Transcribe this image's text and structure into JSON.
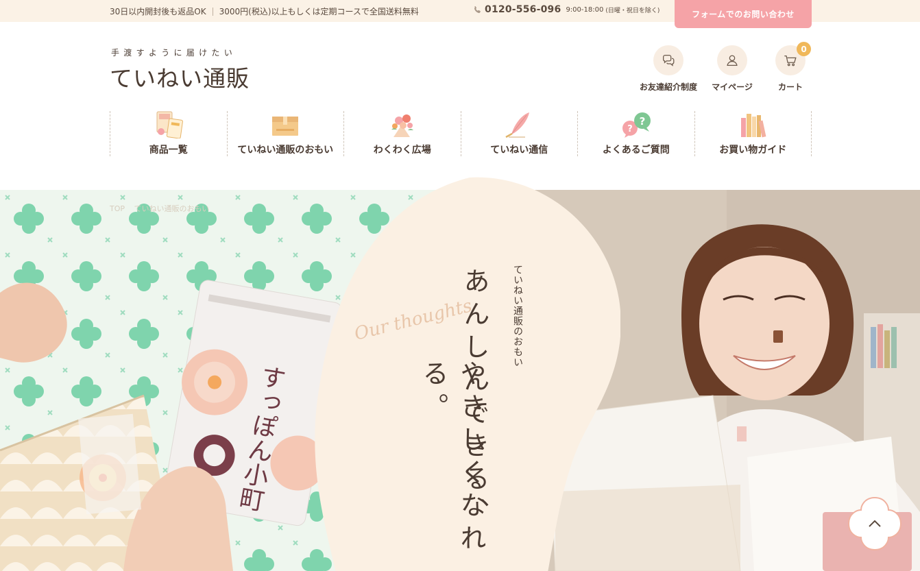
{
  "topbar": {
    "notice_left": "30日以内開封後も返品OK",
    "notice_right": "3000円(税込)以上もしくは定期コースで全国送料無料",
    "phone_number": "0120-556-096",
    "phone_hours": "9:00-18:00",
    "phone_days": "(日曜・祝日を除く)",
    "contact_label": "フォームでのお問い合わせ"
  },
  "logo": {
    "tagline": "手渡すように届けたい",
    "name": "ていねい通販"
  },
  "header_icons": {
    "friend": "お友達紹介制度",
    "mypage": "マイページ",
    "cart": "カート",
    "cart_count": "0"
  },
  "nav": {
    "items": [
      {
        "label": "商品一覧",
        "icon": "products-icon"
      },
      {
        "label": "ていねい通販のおもい",
        "icon": "box-icon"
      },
      {
        "label": "わくわく広場",
        "icon": "flowers-icon"
      },
      {
        "label": "ていねい通信",
        "icon": "feather-pen-icon"
      },
      {
        "label": "よくあるご質問",
        "icon": "question-bubble-icon"
      },
      {
        "label": "お買い物ガイド",
        "icon": "books-icon"
      }
    ]
  },
  "hero": {
    "breadcrumb": [
      "TOP",
      "ていねい通販のおもい"
    ],
    "script_text": "Our thoughts",
    "sub_title": "ていねい通販のおもい",
    "main_line1": "あんしんできる、",
    "main_line2": "やさしくなれる。",
    "package_text": "すっぽん小町"
  },
  "colors": {
    "accent_pink": "#f5a3a7",
    "badge_orange": "#f0b85a",
    "cream": "#fbf2e6",
    "text_brown": "#4a3b32"
  }
}
